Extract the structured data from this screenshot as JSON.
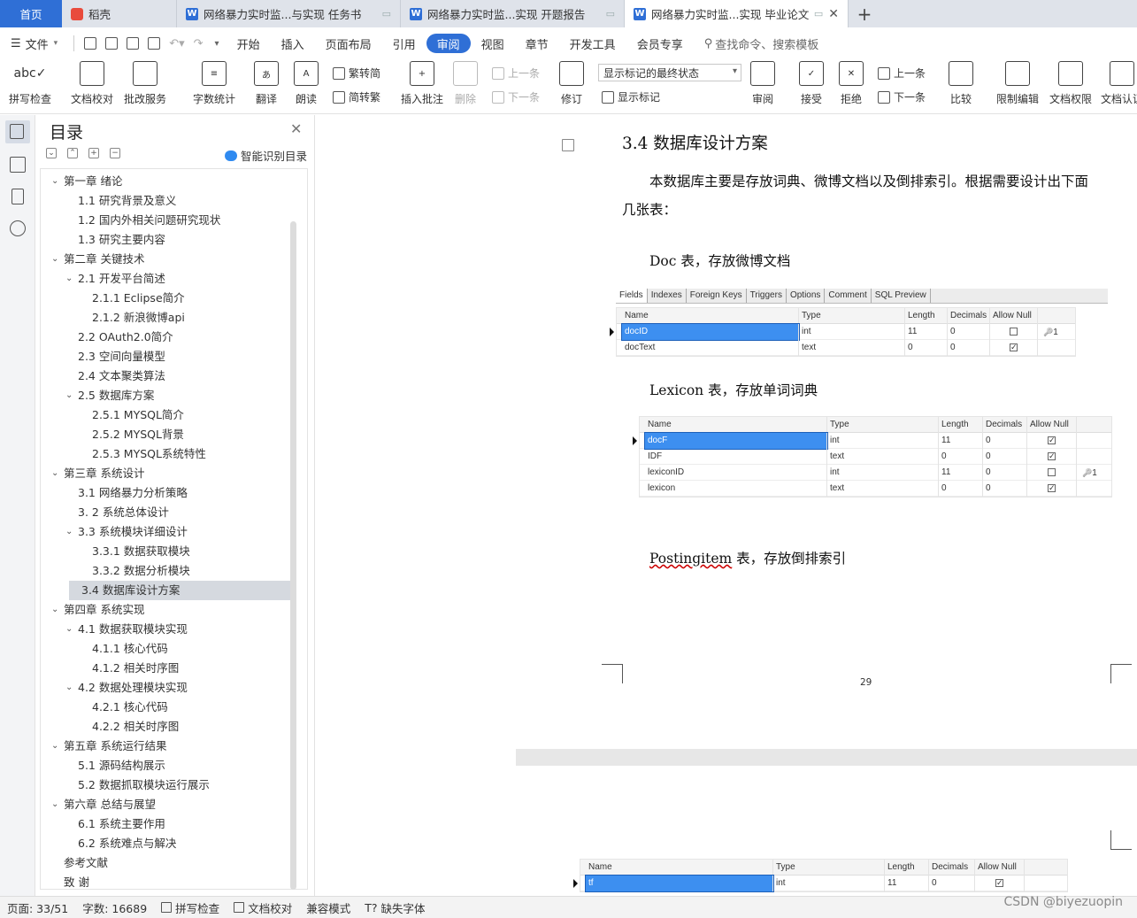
{
  "tabs": [
    {
      "label": "首页"
    },
    {
      "label": "稻壳"
    },
    {
      "label": "网络暴力实时监...与实现 任务书"
    },
    {
      "label": "网络暴力实时监...实现 开题报告"
    },
    {
      "label": "网络暴力实时监...实现 毕业论文"
    }
  ],
  "menu": {
    "file": "文件",
    "items": [
      "开始",
      "插入",
      "页面布局",
      "引用",
      "审阅",
      "视图",
      "章节",
      "开发工具",
      "会员专享"
    ],
    "active": "审阅",
    "search": "查找命令、搜索模板"
  },
  "ribbon": {
    "spell": "拼写检查",
    "proof": "文档校对",
    "batch": "批改服务",
    "wordcount": "字数统计",
    "translate": "翻译",
    "read": "朗读",
    "trad": "繁转简",
    "simp": "简转繁",
    "insert_comment": "插入批注",
    "delete": "删除",
    "prev_comment": "上一条",
    "next_comment": "下一条",
    "revise": "修订",
    "markup_state": "显示标记的最终状态",
    "show_markup": "显示标记",
    "review": "审阅",
    "accept": "接受",
    "reject": "拒绝",
    "prev": "上一条",
    "next": "下一条",
    "compare": "比较",
    "restrict": "限制编辑",
    "doc_perm": "文档权限",
    "doc_cert": "文档认证"
  },
  "toc": {
    "title": "目录",
    "smart": "智能识别目录",
    "items": [
      {
        "text": "第一章 绪论",
        "level": 1,
        "arrow": true
      },
      {
        "text": "1.1 研究背景及意义",
        "level": 2
      },
      {
        "text": "1.2 国内外相关问题研究现状",
        "level": 2
      },
      {
        "text": "1.3 研究主要内容",
        "level": 2
      },
      {
        "text": "第二章 关键技术",
        "level": 1,
        "arrow": true
      },
      {
        "text": "2.1 开发平台简述",
        "level": 2,
        "arrow": true
      },
      {
        "text": "2.1.1 Eclipse简介",
        "level": 3
      },
      {
        "text": "2.1.2 新浪微博api",
        "level": 3
      },
      {
        "text": "2.2 OAuth2.0简介",
        "level": 2
      },
      {
        "text": "2.3 空间向量模型",
        "level": 2
      },
      {
        "text": "2.4 文本聚类算法",
        "level": 2
      },
      {
        "text": "2.5 数据库方案",
        "level": 2,
        "arrow": true
      },
      {
        "text": "2.5.1 MYSQL简介",
        "level": 3
      },
      {
        "text": "2.5.2 MYSQL背景",
        "level": 3
      },
      {
        "text": "2.5.3 MYSQL系统特性",
        "level": 3
      },
      {
        "text": "第三章 系统设计",
        "level": 1,
        "arrow": true
      },
      {
        "text": "3.1 网络暴力分析策略",
        "level": 2
      },
      {
        "text": "3. 2 系统总体设计",
        "level": 2
      },
      {
        "text": "3.3 系统模块详细设计",
        "level": 2,
        "arrow": true
      },
      {
        "text": "3.3.1 数据获取模块",
        "level": 3
      },
      {
        "text": "3.3.2 数据分析模块",
        "level": 3
      },
      {
        "text": "3.4 数据库设计方案",
        "level": 2,
        "selected": true
      },
      {
        "text": "第四章 系统实现",
        "level": 1,
        "arrow": true
      },
      {
        "text": "4.1 数据获取模块实现",
        "level": 2,
        "arrow": true
      },
      {
        "text": "4.1.1 核心代码",
        "level": 3
      },
      {
        "text": "4.1.2 相关时序图",
        "level": 3
      },
      {
        "text": "4.2 数据处理模块实现",
        "level": 2,
        "arrow": true
      },
      {
        "text": "4.2.1 核心代码",
        "level": 3
      },
      {
        "text": "4.2.2 相关时序图",
        "level": 3
      },
      {
        "text": "第五章 系统运行结果",
        "level": 1,
        "arrow": true
      },
      {
        "text": "5.1 源码结构展示",
        "level": 2
      },
      {
        "text": "5.2 数据抓取模块运行展示",
        "level": 2
      },
      {
        "text": "第六章 总结与展望",
        "level": 1,
        "arrow": true
      },
      {
        "text": "6.1 系统主要作用",
        "level": 2
      },
      {
        "text": "6.2 系统难点与解决",
        "level": 2
      },
      {
        "text": "参考文献",
        "level": 1
      },
      {
        "text": "致 谢",
        "level": 1
      }
    ]
  },
  "doc": {
    "heading": "3.4 数据库设计方案",
    "para1_line1": "本数据库主要是存放词典、微博文档以及倒排索引。根据需要设计出下面",
    "para1_line2": "几张表：",
    "doc_caption": "Doc 表，存放微博文档",
    "lexicon_caption": "Lexicon 表，存放单词词典",
    "posting_word": "Postingitem",
    "posting_rest": " 表，存放倒排索引",
    "page_number": "29"
  },
  "doc_table": {
    "tabs": [
      "Fields",
      "Indexes",
      "Foreign Keys",
      "Triggers",
      "Options",
      "Comment",
      "SQL Preview"
    ],
    "headers": [
      "Name",
      "Type",
      "Length",
      "Decimals",
      "Allow Null"
    ],
    "rows": [
      {
        "name": "docID",
        "type": "int",
        "length": "11",
        "decimals": "0",
        "null": false,
        "key": "1",
        "selected": true
      },
      {
        "name": "docText",
        "type": "text",
        "length": "0",
        "decimals": "0",
        "null": true,
        "key": ""
      }
    ]
  },
  "lexicon_table": {
    "headers": [
      "Name",
      "Type",
      "Length",
      "Decimals",
      "Allow Null"
    ],
    "rows": [
      {
        "name": "docF",
        "type": "int",
        "length": "11",
        "decimals": "0",
        "null": true,
        "key": "",
        "selected": true
      },
      {
        "name": "IDF",
        "type": "text",
        "length": "0",
        "decimals": "0",
        "null": true,
        "key": ""
      },
      {
        "name": "lexiconID",
        "type": "int",
        "length": "11",
        "decimals": "0",
        "null": false,
        "key": "1"
      },
      {
        "name": "lexicon",
        "type": "text",
        "length": "0",
        "decimals": "0",
        "null": true,
        "key": ""
      }
    ]
  },
  "posting_table": {
    "headers": [
      "Name",
      "Type",
      "Length",
      "Decimals",
      "Allow Null"
    ],
    "rows": [
      {
        "name": "tf",
        "type": "int",
        "length": "11",
        "decimals": "0",
        "null": true,
        "key": "",
        "selected": true
      }
    ]
  },
  "status": {
    "page": "页面: 33/51",
    "words": "字数: 16689",
    "spell": "拼写检查",
    "proof": "文档校对",
    "compat": "兼容模式",
    "missing_font": "缺失字体"
  },
  "watermark": "CSDN @biyezuopin"
}
